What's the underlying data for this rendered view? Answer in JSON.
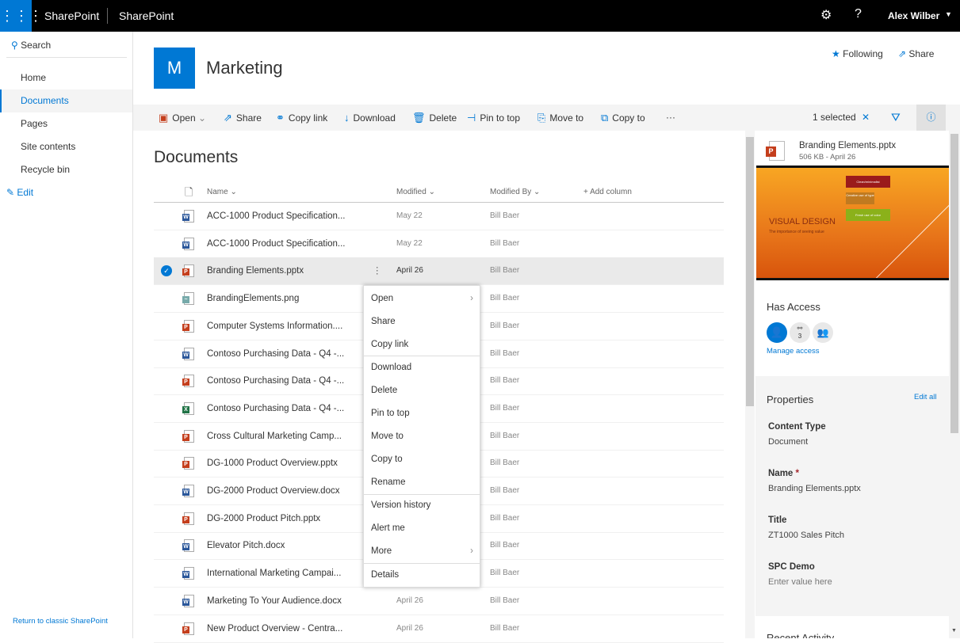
{
  "topbar": {
    "app": "SharePoint",
    "site": "SharePoint",
    "user": "Alex Wilber"
  },
  "nav": {
    "search": "Search",
    "items": [
      "Home",
      "Documents",
      "Pages",
      "Site contents",
      "Recycle bin"
    ],
    "edit": "Edit",
    "classic": "Return to classic SharePoint"
  },
  "site": {
    "logo_letter": "M",
    "title": "Marketing",
    "following": "Following",
    "share": "Share",
    "accent": "#0078d4"
  },
  "cmd": {
    "open": "Open",
    "share": "Share",
    "copy_link": "Copy link",
    "download": "Download",
    "delete": "Delete",
    "pin": "Pin to top",
    "move": "Move to",
    "copy": "Copy to",
    "more": "···",
    "selected": "1 selected"
  },
  "list": {
    "title": "Documents",
    "headers": {
      "name": "Name",
      "modified": "Modified",
      "modified_by": "Modified By",
      "add": "Add column"
    },
    "rows": [
      {
        "name": "ACC-1000 Product Specification...",
        "type": "word",
        "modified": "May 22",
        "by": "Bill Baer"
      },
      {
        "name": "ACC-1000 Product Specification...",
        "type": "word",
        "modified": "May 22",
        "by": "Bill Baer"
      },
      {
        "name": "Branding Elements.pptx",
        "type": "ppt",
        "modified": "April 26",
        "by": "Bill Baer",
        "selected": true
      },
      {
        "name": "BrandingElements.png",
        "type": "img",
        "modified": "",
        "by": "Bill Baer"
      },
      {
        "name": "Computer Systems Information....",
        "type": "ppt",
        "modified": "",
        "by": "Bill Baer"
      },
      {
        "name": "Contoso Purchasing Data - Q4 -...",
        "type": "word",
        "modified": "",
        "by": "Bill Baer"
      },
      {
        "name": "Contoso Purchasing Data - Q4 -...",
        "type": "ppt",
        "modified": "",
        "by": "Bill Baer"
      },
      {
        "name": "Contoso Purchasing Data - Q4 -...",
        "type": "excel",
        "modified": "",
        "by": "Bill Baer"
      },
      {
        "name": "Cross Cultural Marketing Camp...",
        "type": "ppt",
        "modified": "",
        "by": "Bill Baer"
      },
      {
        "name": "DG-1000 Product Overview.pptx",
        "type": "ppt",
        "modified": "",
        "by": "Bill Baer"
      },
      {
        "name": "DG-2000 Product Overview.docx",
        "type": "word",
        "modified": "",
        "by": "Bill Baer"
      },
      {
        "name": "DG-2000 Product Pitch.pptx",
        "type": "ppt",
        "modified": "",
        "by": "Bill Baer"
      },
      {
        "name": "Elevator Pitch.docx",
        "type": "word",
        "modified": "",
        "by": "Bill Baer"
      },
      {
        "name": "International Marketing Campai...",
        "type": "word",
        "modified": "",
        "by": "Bill Baer"
      },
      {
        "name": "Marketing To Your Audience.docx",
        "type": "word",
        "modified": "April 26",
        "by": "Bill Baer"
      },
      {
        "name": "New Product Overview - Centra...",
        "type": "ppt",
        "modified": "April 26",
        "by": "Bill Baer"
      }
    ]
  },
  "menu": {
    "items": [
      "Open",
      "Share",
      "Copy link",
      "Download",
      "Delete",
      "Pin to top",
      "Move to",
      "Copy to",
      "Rename",
      "Version history",
      "Alert me",
      "More",
      "Details"
    ]
  },
  "details": {
    "file": "Branding Elements.pptx",
    "meta": "506 KB - April 26",
    "preview": {
      "title": "VISUAL DESIGN",
      "subtitle": "The importance of seeing value",
      "tiles": [
        "Clean/minimalist",
        "Creative use of type",
        "Fresh use of color"
      ]
    },
    "has_access": "Has Access",
    "share_count": "3",
    "manage": "Manage access",
    "properties": "Properties",
    "edit_all": "Edit all",
    "fields": [
      {
        "label": "Content Type",
        "value": "Document"
      },
      {
        "label": "Name",
        "value": "Branding Elements.pptx",
        "required": "*"
      },
      {
        "label": "Title",
        "value": "ZT1000 Sales Pitch"
      },
      {
        "label": "SPC Demo",
        "value": "Enter value here"
      }
    ],
    "recent": "Recent Activity"
  }
}
